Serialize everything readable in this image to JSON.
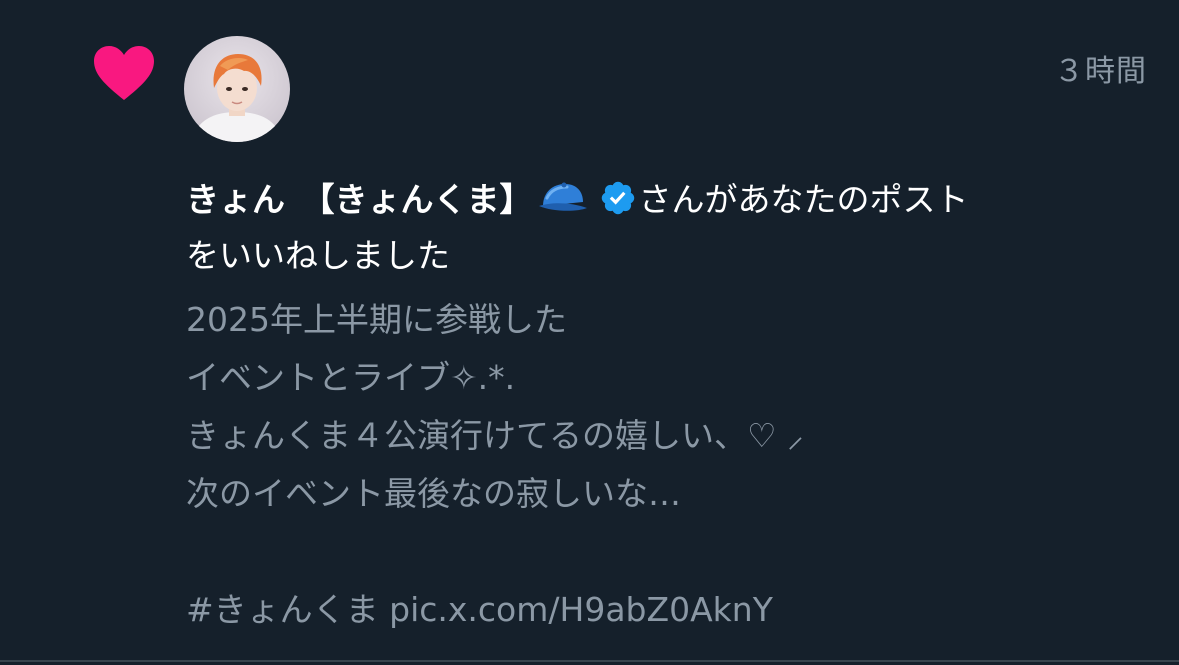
{
  "colors": {
    "background": "#15202b",
    "heart": "#f91880",
    "primary_text": "#ffffff",
    "secondary_text": "#8b98a5",
    "verified": "#1d9bf0",
    "divider": "#38444d"
  },
  "notification": {
    "type_icon": "heart-icon",
    "avatar_icon": "user-avatar",
    "timestamp": "３時間",
    "user_name": "きょん　【きょんくま】",
    "name_emoji_icon": "blue-cap-icon",
    "verified_icon": "verified-badge-icon",
    "action_text_line1": "さんがあなたのポスト",
    "action_text_line2": "をいいねしました",
    "post_lines": [
      "2025年上半期に参戦した",
      "イベントとライブ✧.*.",
      "きょんくま４公演行けてるの嬉しい、♡ ⸝",
      "次のイベント最後なの寂しいな…",
      "",
      "#きょんくま pic.x.com/H9abZ0AknY"
    ]
  }
}
